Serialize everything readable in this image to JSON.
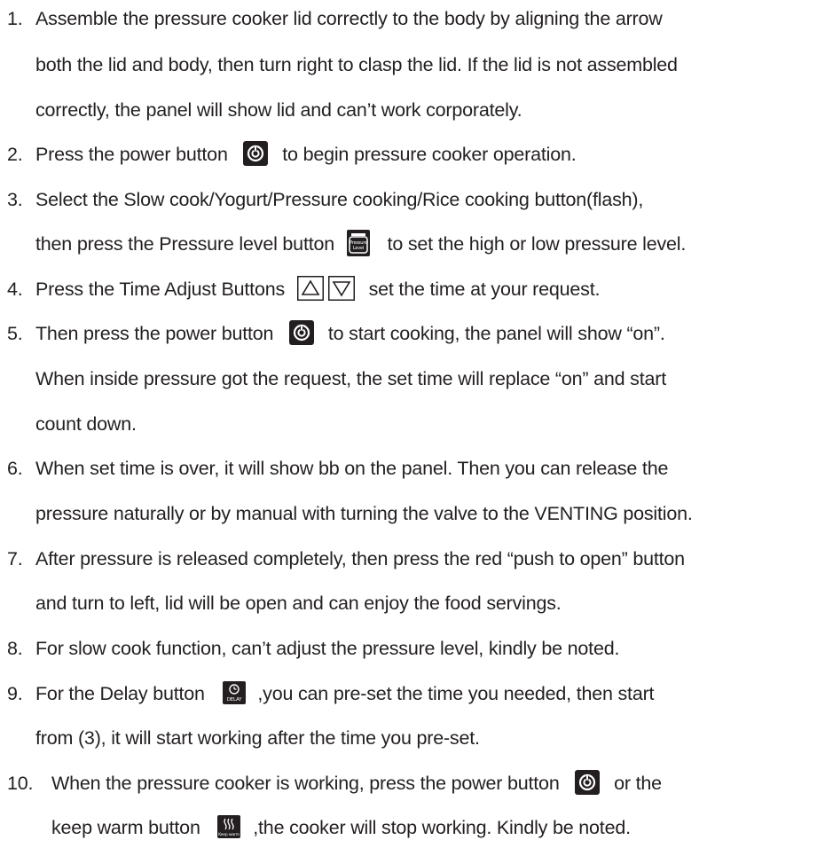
{
  "items": [
    {
      "number": "1.",
      "lines": [
        "Assemble the pressure cooker lid correctly to the body by aligning the arrow",
        "both the lid and body, then turn right to clasp the lid. If the lid is not assembled",
        "correctly, the panel will show lid and can’t work corporately."
      ]
    },
    {
      "number": "2.",
      "line1_before": "Press the power button",
      "line1_after": "to begin pressure cooker operation."
    },
    {
      "number": "3.",
      "line1": "Select the Slow cook/Yogurt/Pressure cooking/Rice cooking button(flash),",
      "line2_before": "then press the Pressure level button",
      "line2_after": "to set the high or low pressure level."
    },
    {
      "number": "4.",
      "line1_before": "Press the Time Adjust Buttons",
      "line1_after": "set the time at your request."
    },
    {
      "number": "5.",
      "line1_before": "Then press the power button",
      "line1_after": "to start cooking, the panel will show “on”.",
      "line2": "When inside pressure got the request, the set time will replace “on” and start",
      "line3": "count down."
    },
    {
      "number": "6.",
      "lines": [
        "When set time is over, it will show bb on the panel. Then you can release the",
        "pressure naturally or by manual with turning the valve to the VENTING position."
      ]
    },
    {
      "number": "7.",
      "lines": [
        "After pressure is released completely, then press the red “push to open” button",
        "and turn to left, lid will be open and can enjoy the food servings."
      ]
    },
    {
      "number": "8.",
      "line1": "For slow cook function, can’t adjust the pressure level, kindly be noted."
    },
    {
      "number": "9.",
      "line1_before": "For the Delay button",
      "line1_after": ",you can pre-set the time you needed, then start",
      "line2": "from (3), it will start working after the time you pre-set."
    },
    {
      "number": "10.",
      "line1_before": "When the pressure cooker is working, press the power button",
      "line1_after": "or the",
      "line2_before": "keep warm button",
      "line2_after": ",the cooker will stop working. Kindly be noted."
    }
  ],
  "icons": {
    "power": "power-icon",
    "pressure_level": "pressure-level-icon",
    "pressure_level_text_1": "Pressure",
    "pressure_level_text_2": "Level",
    "time_up": "triangle-up-icon",
    "time_down": "triangle-down-icon",
    "delay": "delay-icon",
    "delay_text": "DELAY",
    "keep_warm": "keep-warm-icon",
    "keep_warm_text": "Keep warm",
    "icon_color": "#231f20"
  }
}
